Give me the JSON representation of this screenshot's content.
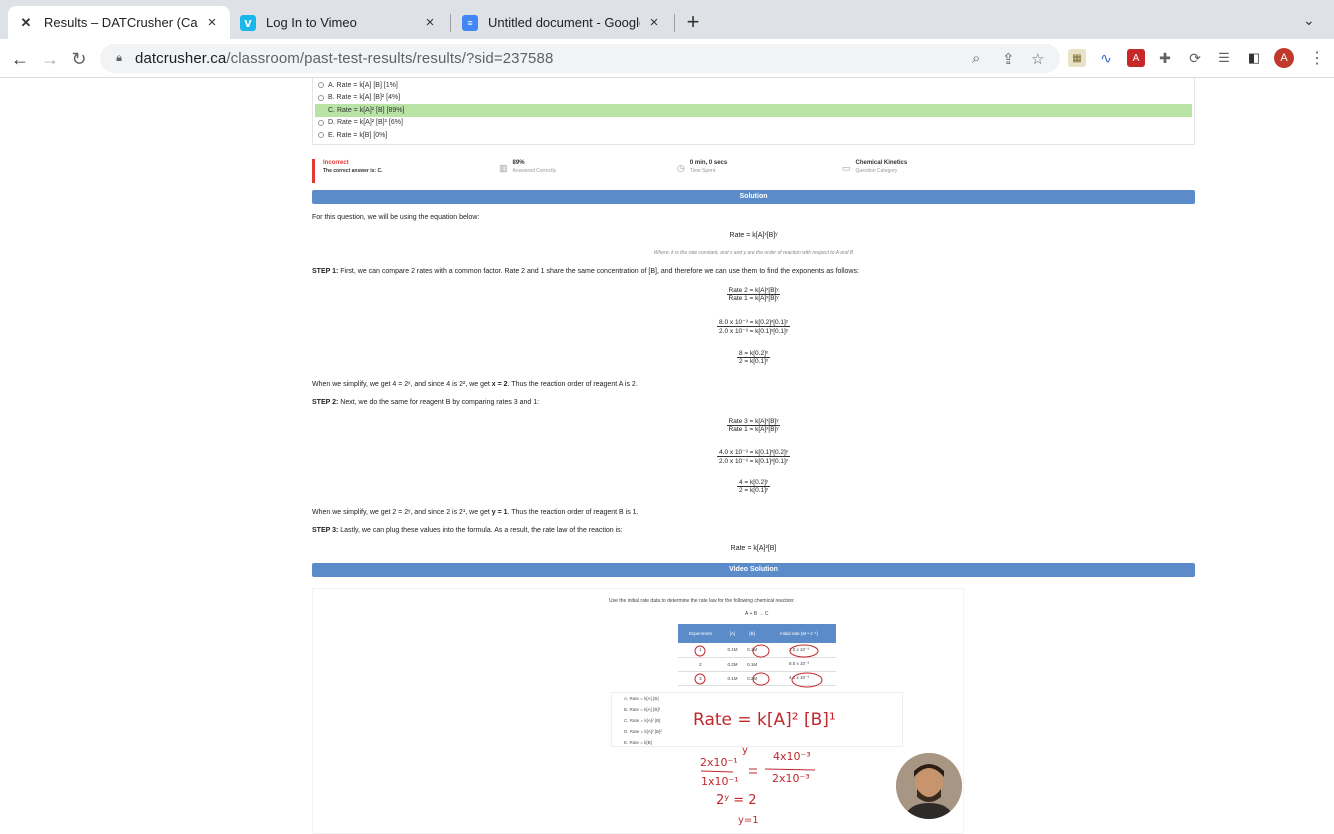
{
  "browser": {
    "tabs": [
      {
        "title": "Results – DATCrusher (Canada)",
        "active": true
      },
      {
        "title": "Log In to Vimeo",
        "active": false
      },
      {
        "title": "Untitled document - Google Docs",
        "active": false
      }
    ],
    "address": {
      "host": "datcrusher.ca",
      "path": "/classroom/past-test-results/results/?sid=237588"
    },
    "profile_initial": "A",
    "colors": {
      "tabbar": "#dee1e6",
      "accent_blue": "#5b8cc9"
    }
  },
  "question": {
    "answers": [
      {
        "label": "A. Rate = k[A] [B] [1%]",
        "correct": false
      },
      {
        "label": "B. Rate = k[A] [B]² [4%]",
        "correct": false
      },
      {
        "label": "C. Rate = k[A]² [B] [89%]",
        "correct": true
      },
      {
        "label": "D. Rate = k[A]² [B]² [6%]",
        "correct": false
      },
      {
        "label": "E. Rate = k[B] [0%]",
        "correct": false
      }
    ],
    "result": {
      "status": "Incorrect",
      "correct_answer": "The correct answer is: C.",
      "percent": "89%",
      "percent_label": "Answered Correctly",
      "time": "0 min, 0 secs",
      "time_label": "Time Spent",
      "category": "Chemical Kinetics",
      "category_label": "Question Category"
    }
  },
  "solution": {
    "banner": "Solution",
    "intro": "For this question, we will be using the equation below:",
    "rate_eq": "Rate = k[A]ˣ[B]ʸ",
    "rate_note": "Where, k is the rate constant, and x and y are the order of reaction with respect to A and B",
    "step1_label": "STEP 1:",
    "step1_text": " First, we can compare 2 rates with a common factor. Rate 2 and 1 share the same concentration of [B], and therefore we can use them to find the exponents as follows:",
    "f1_num": "Rate 2 = k[A]ˣ[B]ʸ",
    "f1_den": "Rate 1 = k[A]ˣ[B]ʸ",
    "f2_num": "8.0 x 10⁻³ = k[0.2]ˣ[0.1]ʸ",
    "f2_den": "2.0 x 10⁻³ = k[0.1]ˣ[0.1]ʸ",
    "f3_num": "8 = k[0.2]ˣ",
    "f3_den": "2 = k[0.1]ˣ",
    "simplify1_a": "When we simplify, we get 4 = 2ˣ, and since 4 is 2², we get ",
    "simplify1_b": "x = 2",
    "simplify1_c": ". Thus the reaction order of reagent A is 2.",
    "step2_label": "STEP 2:",
    "step2_text": " Next, we do the same for reagent B by comparing rates 3 and 1:",
    "g1_num": "Rate 3 = k[A]ˣ[B]ʸ",
    "g1_den": "Rate 1 = k[A]ˣ[B]ʸ",
    "g2_num": "4.0 x 10⁻³ = k[0.1]ˣ[0.2]ʸ",
    "g2_den": "2.0 x 10⁻³ = k[0.1]ˣ[0.1]ʸ",
    "g3_num": "4 = k[0.2]ʸ",
    "g3_den": "2 = k[0.1]ʸ",
    "simplify2_a": "When we simplify, we get 2 = 2ʸ, and since 2 is 2¹, we get ",
    "simplify2_b": "y = 1",
    "simplify2_c": ". Thus the reaction order of reagent B is 1.",
    "step3_label": "STEP 3:",
    "step3_text": " Lastly, we can plug these values into the formula. As a result, the rate law of the reaction is:",
    "final_eq": "Rate = k[A]²[B]"
  },
  "video": {
    "banner": "Video Solution",
    "prompt": "Use the initial rate data to determine the rate law for the following chemical reaction:",
    "reaction": "A + B → C",
    "table_headers": [
      "Experiment",
      "[A]",
      "[B]",
      "Initial rate (M • s⁻¹)"
    ],
    "table_rows": [
      [
        "1",
        "0.1M",
        "0.1M",
        "2.0 x 10⁻³"
      ],
      [
        "2",
        "0.2M",
        "0.1M",
        "8.0 x 10⁻³"
      ],
      [
        "3",
        "0.1M",
        "0.2M",
        "4.0 x 10⁻³"
      ]
    ],
    "choices": [
      "A. Rate = k[A] [B]",
      "B. Rate = k[A] [B]²",
      "C. Rate = k[A]² [B]",
      "D. Rate = k[A]² [B]²",
      "E. Rate = k[B]"
    ],
    "handwriting": {
      "rate_law": "Rate = k[A]² [B]¹",
      "left_num": "2x10⁻¹",
      "left_den": "1x10⁻¹",
      "exp_y": "y",
      "right_num": "4x10⁻³",
      "right_den": "2x10⁻³",
      "eq2": "2ʸ = 2",
      "eq3": "y=1"
    }
  }
}
